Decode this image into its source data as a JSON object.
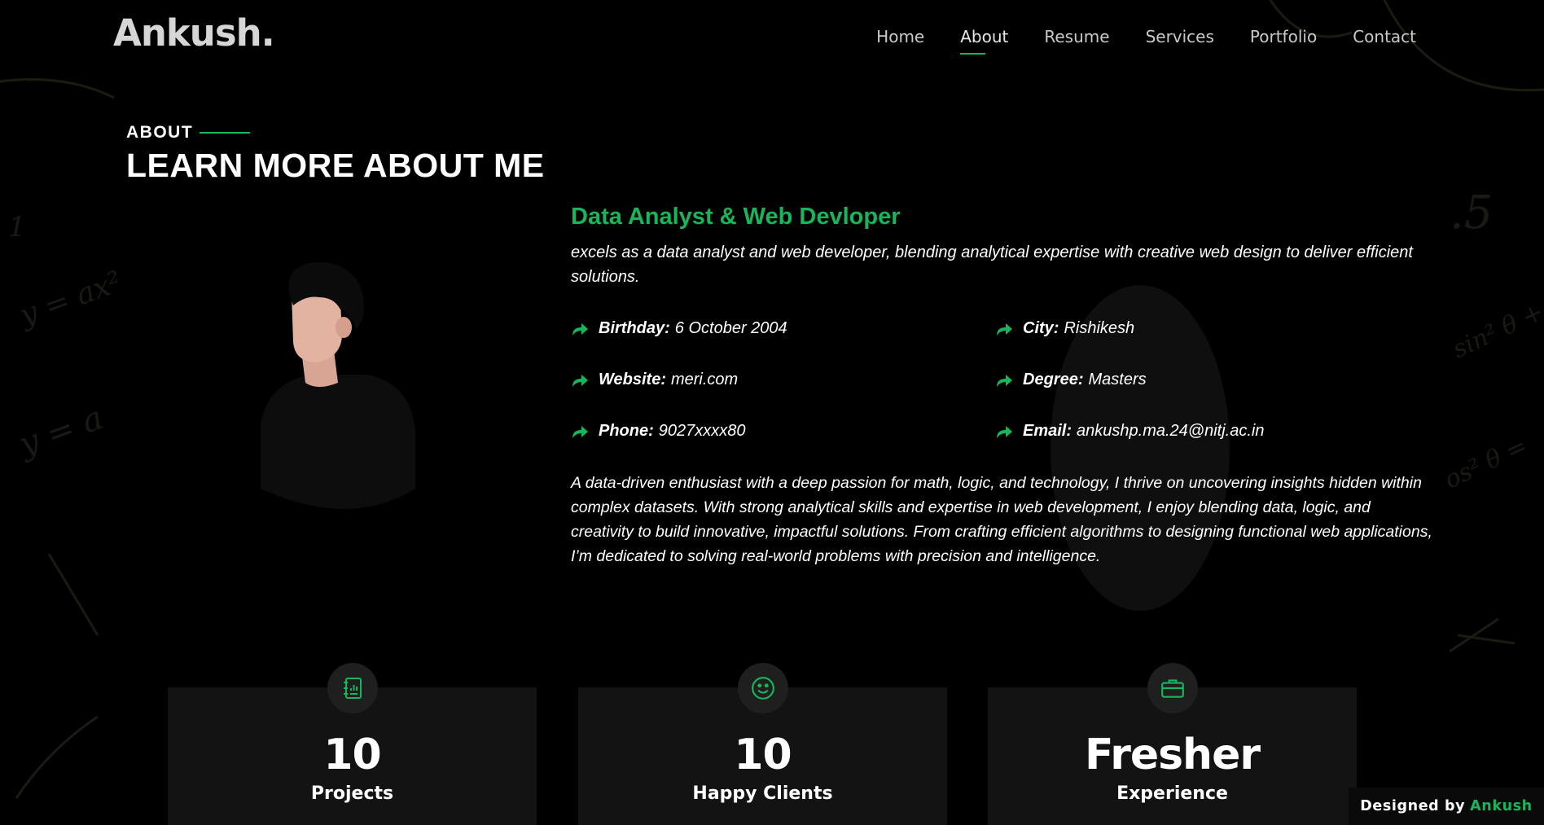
{
  "brand": {
    "logo": "Ankush."
  },
  "nav": {
    "items": [
      {
        "label": "Home"
      },
      {
        "label": "About"
      },
      {
        "label": "Resume"
      },
      {
        "label": "Services"
      },
      {
        "label": "Portfolio"
      },
      {
        "label": "Contact"
      }
    ],
    "active": "About"
  },
  "about": {
    "eyebrow": "ABOUT",
    "title": "LEARN MORE ABOUT ME",
    "role": "Data Analyst & Web Devloper",
    "intro": "excels as a data analyst and web developer, blending analytical expertise with creative web design to deliver efficient solutions.",
    "facts": [
      {
        "label": "Birthday:",
        "value": "6 October 2004"
      },
      {
        "label": "City:",
        "value": "Rishikesh"
      },
      {
        "label": "Website:",
        "value": "meri.com"
      },
      {
        "label": "Degree:",
        "value": "Masters"
      },
      {
        "label": "Phone:",
        "value": "9027xxxx80"
      },
      {
        "label": "Email:",
        "value": "ankushp.ma.24@nitj.ac.in"
      }
    ],
    "bio": "A data-driven enthusiast with a deep passion for math, logic, and technology, I thrive on uncovering insights hidden within complex datasets. With strong analytical skills and expertise in web development, I enjoy blending data, logic, and creativity to build innovative, impactful solutions. From crafting efficient algorithms to designing functional web applications, I’m dedicated to solving real-world problems with precision and intelligence."
  },
  "stats": [
    {
      "icon": "journal-chart-icon",
      "value": "10",
      "label": "Projects"
    },
    {
      "icon": "smiley-icon",
      "value": "10",
      "label": "Happy Clients"
    },
    {
      "icon": "briefcase-icon",
      "value": "Fresher",
      "label": "Experience"
    }
  ],
  "footer": {
    "credit_prefix": "Designed by",
    "credit_name": "Ankush"
  },
  "colors": {
    "accent": "#18b65a",
    "background": "#000000",
    "card": "#131313"
  }
}
